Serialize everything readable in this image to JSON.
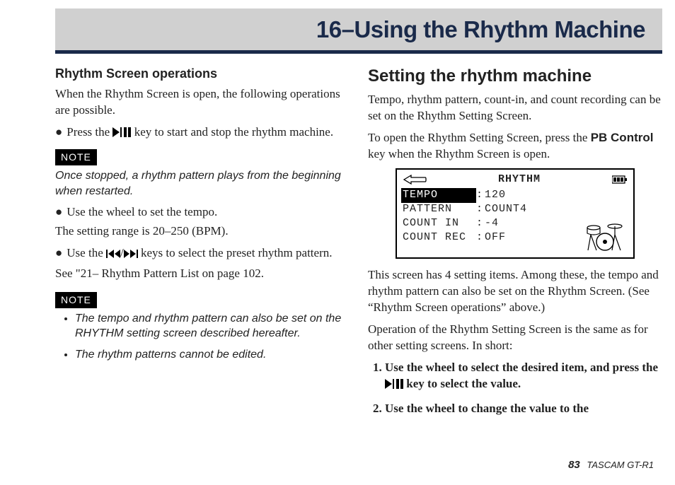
{
  "header": {
    "title": "16–Using the Rhythm Machine"
  },
  "left": {
    "h": "Rhythm Screen operations",
    "intro": "When the Rhythm Screen is open, the following operations are possible.",
    "b1a": "Press the ",
    "b1b": " key to start and stop the rhythm machine.",
    "note_label": "NOTE",
    "note1": "Once stopped, a rhythm pattern plays from the beginning when restarted.",
    "b2": "Use the wheel to set the tempo.",
    "range": "The setting range is 20–250 (BPM).",
    "b3a": "Use the ",
    "b3b": " keys to select the preset rhythm pattern.",
    "see": "See \"21– Rhythm Pattern List on page 102.",
    "nlist1": "The tempo and rhythm pattern can also be set on the RHYTHM setting screen described hereafter.",
    "nlist2": "The rhythm patterns cannot be edited."
  },
  "right": {
    "h": "Setting the rhythm machine",
    "p1": "Tempo, rhythm pattern, count-in, and count recording can be set on the Rhythm Setting Screen.",
    "p2a": "To open the Rhythm Setting Screen, press the ",
    "p2_key": "PB Control",
    "p2b": " key when the Rhythm Screen is open.",
    "lcd": {
      "title": "RHYTHM",
      "rows": [
        {
          "label": "TEMPO",
          "val": "120",
          "inv": true
        },
        {
          "label": "PATTERN",
          "val": "COUNT4",
          "inv": false
        },
        {
          "label": "COUNT IN",
          "val": "-4",
          "inv": false
        },
        {
          "label": "COUNT REC",
          "val": "OFF",
          "inv": false
        }
      ]
    },
    "p3": "This screen has 4 setting items. Among these, the tempo and rhythm pattern can also be set on the Rhythm Screen. (See “Rhythm Screen operations” above.)",
    "p4": "Operation of the Rhythm Setting Screen is the same as for other setting screens. In short:",
    "step1a": "Use the wheel to select the desired item, and press the ",
    "step1b": " key to select the value.",
    "step2": "Use the wheel to change the value to the"
  },
  "footer": {
    "page": "83",
    "product": "TASCAM  GT-R1"
  }
}
